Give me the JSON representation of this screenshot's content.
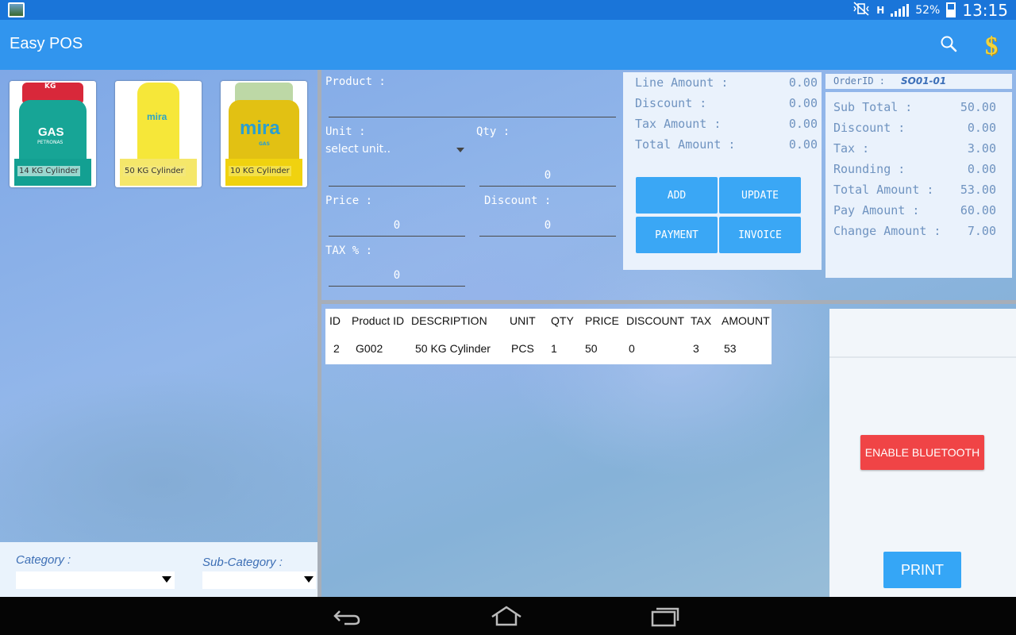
{
  "status_bar": {
    "network": "H",
    "battery": "52%",
    "clock": "13:15"
  },
  "app": {
    "title": "Easy POS"
  },
  "products": [
    {
      "label": "14 KG Cylinder",
      "brand_top": "KG",
      "brand": "GAS",
      "brand_sub": "PETRONAS",
      "color": "#1aa39a"
    },
    {
      "label": "50 KG Cylinder",
      "brand": "mira",
      "color": "#f3e43a"
    },
    {
      "label": "10 KG Cylinder",
      "brand": "mira",
      "brand_sub": "GAS",
      "color": "#e5c414"
    }
  ],
  "form": {
    "product_label": "Product :",
    "unit_label": "Unit :",
    "unit_placeholder": "select unit..",
    "qty_label": "Qty :",
    "qty_value": "0",
    "price_label": "Price :",
    "price_value": "0",
    "discount_label": "Discount :",
    "discount_value": "0",
    "tax_label": "TAX % :",
    "tax_value": "0"
  },
  "line_totals": {
    "line_amount_label": "Line Amount :",
    "line_amount": "0.00",
    "discount_label": "Discount :",
    "discount": "0.00",
    "tax_amount_label": "Tax Amount :",
    "tax_amount": "0.00",
    "total_amount_label": "Total Amount :",
    "total_amount": "0.00"
  },
  "buttons": {
    "add": "ADD",
    "update": "UPDATE",
    "payment": "PAYMENT",
    "invoice": "INVOICE"
  },
  "order": {
    "id_label": "OrderID :",
    "id_value": "SO01-01",
    "sub_total_label": "Sub Total :",
    "sub_total": "50.00",
    "discount_label": "Discount :",
    "discount": "0.00",
    "tax_label": "Tax :",
    "tax": "3.00",
    "rounding_label": "Rounding :",
    "rounding": "0.00",
    "total_label": "Total Amount :",
    "total": "53.00",
    "pay_label": "Pay Amount :",
    "pay": "60.00",
    "change_label": "Change Amount :",
    "change": "7.00"
  },
  "table": {
    "headers": [
      "ID",
      "Product ID",
      "DESCRIPTION",
      "UNIT",
      "QTY",
      "PRICE",
      "DISCOUNT",
      "TAX",
      "AMOUNT"
    ],
    "rows": [
      [
        "2",
        "G002",
        "50 KG Cylinder",
        "PCS",
        "1",
        "50",
        "0",
        "3",
        "53"
      ]
    ]
  },
  "printer": {
    "bluetooth_button": "ENABLE BLUETOOTH",
    "print_button": "PRINT"
  },
  "filters": {
    "category_label": "Category :",
    "sub_category_label": "Sub-Category :"
  }
}
